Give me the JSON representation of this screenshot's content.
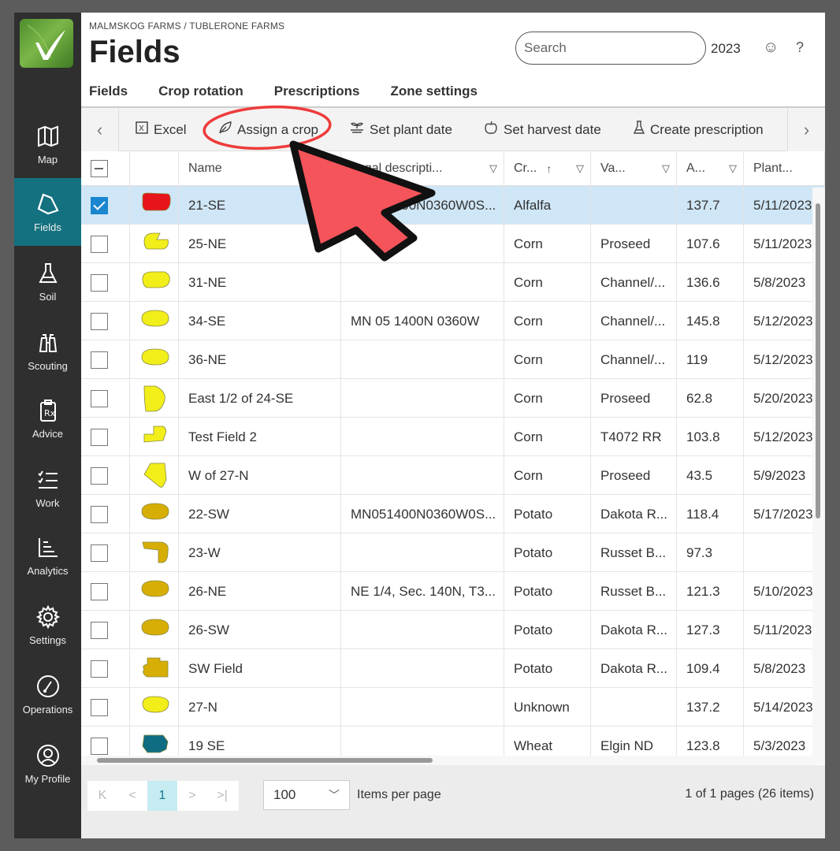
{
  "breadcrumb": "MALMSKOG FARMS / TUBLERONE FARMS",
  "title": "Fields",
  "search": {
    "placeholder": "Search"
  },
  "year": "2023",
  "header_icons": {
    "smiley": "☺",
    "help": "?"
  },
  "sidebar": {
    "items": [
      {
        "label": "Map"
      },
      {
        "label": "Fields"
      },
      {
        "label": "Soil"
      },
      {
        "label": "Scouting"
      },
      {
        "label": "Advice"
      },
      {
        "label": "Work"
      },
      {
        "label": "Analytics"
      },
      {
        "label": "Settings"
      },
      {
        "label": "Operations"
      },
      {
        "label": "My Profile"
      }
    ]
  },
  "tabs": [
    {
      "label": "Fields"
    },
    {
      "label": "Crop rotation"
    },
    {
      "label": "Prescriptions"
    },
    {
      "label": "Zone settings"
    }
  ],
  "toolbar": {
    "excel": "Excel",
    "assign_crop": "Assign a crop",
    "set_plant_date": "Set plant date",
    "set_harvest_date": "Set harvest date",
    "create_prescription": "Create prescription"
  },
  "columns": {
    "name": "Name",
    "description": "Legal descripti...",
    "crop": "Cr...",
    "variety": "Va...",
    "area": "A...",
    "plant": "Plant..."
  },
  "rows": [
    {
      "name": "21-SE",
      "desc": "MN051400N0360W0S...",
      "crop": "Alfalfa",
      "variety": "",
      "area": "137.7",
      "plant": "5/11/2023",
      "shape_color": "#e8141b",
      "checked": true
    },
    {
      "name": "25-NE",
      "desc": "",
      "crop": "Corn",
      "variety": "Proseed",
      "area": "107.6",
      "plant": "5/11/2023",
      "shape_color": "#f2ee1a",
      "checked": false
    },
    {
      "name": "31-NE",
      "desc": "",
      "crop": "Corn",
      "variety": "Channel/...",
      "area": "136.6",
      "plant": "5/8/2023",
      "shape_color": "#f2ee1a",
      "checked": false
    },
    {
      "name": "34-SE",
      "desc": "MN 05 1400N 0360W",
      "crop": "Corn",
      "variety": "Channel/...",
      "area": "145.8",
      "plant": "5/12/2023",
      "shape_color": "#f2ee1a",
      "checked": false
    },
    {
      "name": "36-NE",
      "desc": "",
      "crop": "Corn",
      "variety": "Channel/...",
      "area": "119",
      "plant": "5/12/2023",
      "shape_color": "#f2ee1a",
      "checked": false
    },
    {
      "name": "East 1/2 of 24-SE",
      "desc": "",
      "crop": "Corn",
      "variety": "Proseed",
      "area": "62.8",
      "plant": "5/20/2023",
      "shape_color": "#f2ee1a",
      "checked": false
    },
    {
      "name": "Test Field 2",
      "desc": "",
      "crop": "Corn",
      "variety": "T4072 RR",
      "area": "103.8",
      "plant": "5/12/2023",
      "shape_color": "#f2ee1a",
      "checked": false
    },
    {
      "name": "W of 27-N",
      "desc": "",
      "crop": "Corn",
      "variety": "Proseed",
      "area": "43.5",
      "plant": "5/9/2023",
      "shape_color": "#f2ee1a",
      "checked": false
    },
    {
      "name": "22-SW",
      "desc": "MN051400N0360W0S...",
      "crop": "Potato",
      "variety": "Dakota R...",
      "area": "118.4",
      "plant": "5/17/2023",
      "shape_color": "#d6ae06",
      "checked": false
    },
    {
      "name": "23-W",
      "desc": "",
      "crop": "Potato",
      "variety": "Russet B...",
      "area": "97.3",
      "plant": "",
      "shape_color": "#d6ae06",
      "checked": false
    },
    {
      "name": "26-NE",
      "desc": "NE 1/4, Sec. 140N, T3...",
      "crop": "Potato",
      "variety": "Russet B...",
      "area": "121.3",
      "plant": "5/10/2023",
      "shape_color": "#d6ae06",
      "checked": false
    },
    {
      "name": "26-SW",
      "desc": "",
      "crop": "Potato",
      "variety": "Dakota R...",
      "area": "127.3",
      "plant": "5/11/2023",
      "shape_color": "#d6ae06",
      "checked": false
    },
    {
      "name": "SW Field",
      "desc": "",
      "crop": "Potato",
      "variety": "Dakota R...",
      "area": "109.4",
      "plant": "5/8/2023",
      "shape_color": "#d6ae06",
      "checked": false
    },
    {
      "name": "27-N",
      "desc": "",
      "crop": "Unknown",
      "variety": "",
      "area": "137.2",
      "plant": "5/14/2023",
      "shape_color": "#f2ee1a",
      "checked": false
    },
    {
      "name": "19 SE",
      "desc": "",
      "crop": "Wheat",
      "variety": "Elgin ND",
      "area": "123.8",
      "plant": "5/3/2023",
      "shape_color": "#0f6d82",
      "checked": false
    }
  ],
  "pager": {
    "first": "K",
    "prev": "<",
    "current": "1",
    "next": ">",
    "last": ">|"
  },
  "per_page": {
    "value": "100",
    "label": "Items per page"
  },
  "page_info": "1 of 1 pages (26 items)",
  "colors": {
    "accent": "#14717f",
    "annotation": "#ee3b3b"
  }
}
